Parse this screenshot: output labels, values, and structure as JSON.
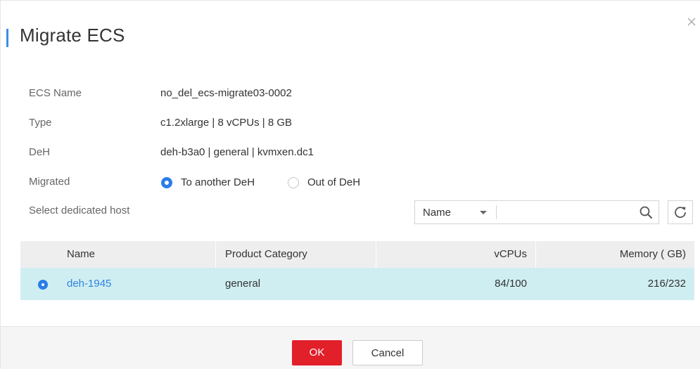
{
  "dialog": {
    "title": "Migrate ECS",
    "close_icon": "close-icon"
  },
  "fields": {
    "ecs_name": {
      "label": "ECS Name",
      "value": "no_del_ecs-migrate03-0002"
    },
    "type": {
      "label": "Type",
      "value": "c1.2xlarge | 8 vCPUs | 8 GB"
    },
    "deh": {
      "label": "DeH",
      "value": "deh-b3a0 | general | kvmxen.dc1"
    },
    "migrated": {
      "label": "Migrated",
      "options": [
        {
          "label": "To another DeH",
          "selected": true
        },
        {
          "label": "Out of DeH",
          "selected": false
        }
      ]
    },
    "select_host": {
      "label": "Select dedicated host"
    }
  },
  "search": {
    "filter_selected": "Name",
    "placeholder": "",
    "search_icon": "search-icon",
    "refresh_icon": "refresh-icon"
  },
  "table": {
    "columns": [
      "Name",
      "Product Category",
      "vCPUs",
      "Memory ( GB)"
    ],
    "rows": [
      {
        "selected": true,
        "name": "deh-1945",
        "category": "general",
        "vcpus": "84/100",
        "memory": "216/232"
      }
    ]
  },
  "footer": {
    "ok_label": "OK",
    "cancel_label": "Cancel"
  },
  "colors": {
    "accent": "#2b7de9",
    "primary_button": "#e2202a",
    "selected_row": "#cfeef2",
    "link": "#2f83e0"
  }
}
